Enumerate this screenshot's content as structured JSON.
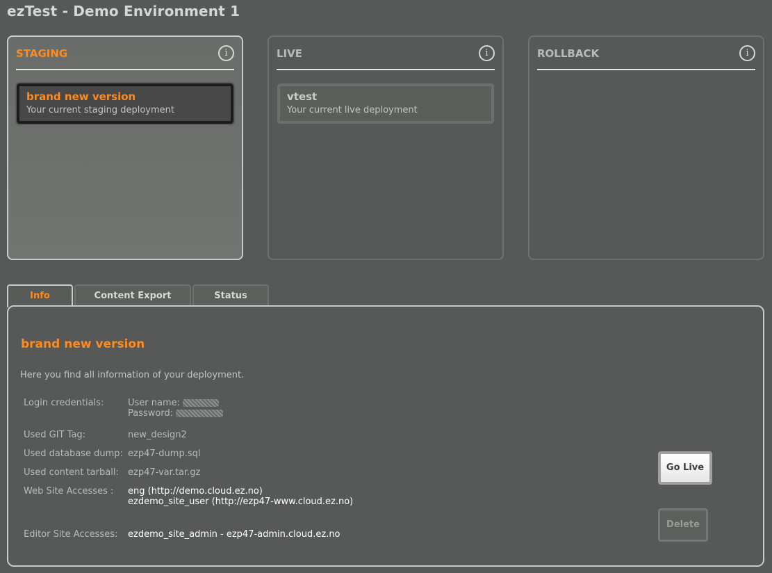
{
  "app": {
    "title": "ezTest - Demo Environment 1"
  },
  "panels": [
    {
      "title": "STAGING",
      "card": {
        "title": "brand new version",
        "subtitle": "Your current staging deployment"
      }
    },
    {
      "title": "LIVE",
      "card": {
        "title": "vtest",
        "subtitle": "Your current live deployment"
      }
    },
    {
      "title": "ROLLBACK"
    }
  ],
  "info_icon_glyph": "i",
  "tabs": [
    {
      "label": "Info",
      "active": true
    },
    {
      "label": "Content Export",
      "active": false
    },
    {
      "label": "Status",
      "active": false
    }
  ],
  "info": {
    "title": "brand new version",
    "description": "Here you find all information of your deployment.",
    "login_label": "Login credentials:",
    "username_label": "User name:",
    "password_label": "Password:",
    "git_tag_label": "Used GIT Tag:",
    "git_tag_value": "new_design2",
    "db_dump_label": "Used database dump:",
    "db_dump_value": "ezp47-dump.sql",
    "tarball_label": "Used content tarball:",
    "tarball_value": "ezp47-var.tar.gz",
    "web_access_label": "Web Site Accesses :",
    "web_access_values": [
      "eng (http://demo.cloud.ez.no)",
      "ezdemo_site_user (http://ezp47-www.cloud.ez.no)"
    ],
    "editor_access_label": "Editor Site Accesses:",
    "editor_access_value": "ezdemo_site_admin - ezp47-admin.cloud.ez.no"
  },
  "buttons": {
    "go_live": "Go Live",
    "delete": "Delete"
  },
  "colors": {
    "accent": "#ff8a1d",
    "background": "#575958"
  },
  "icons": {
    "panel_info": "info-icon"
  }
}
